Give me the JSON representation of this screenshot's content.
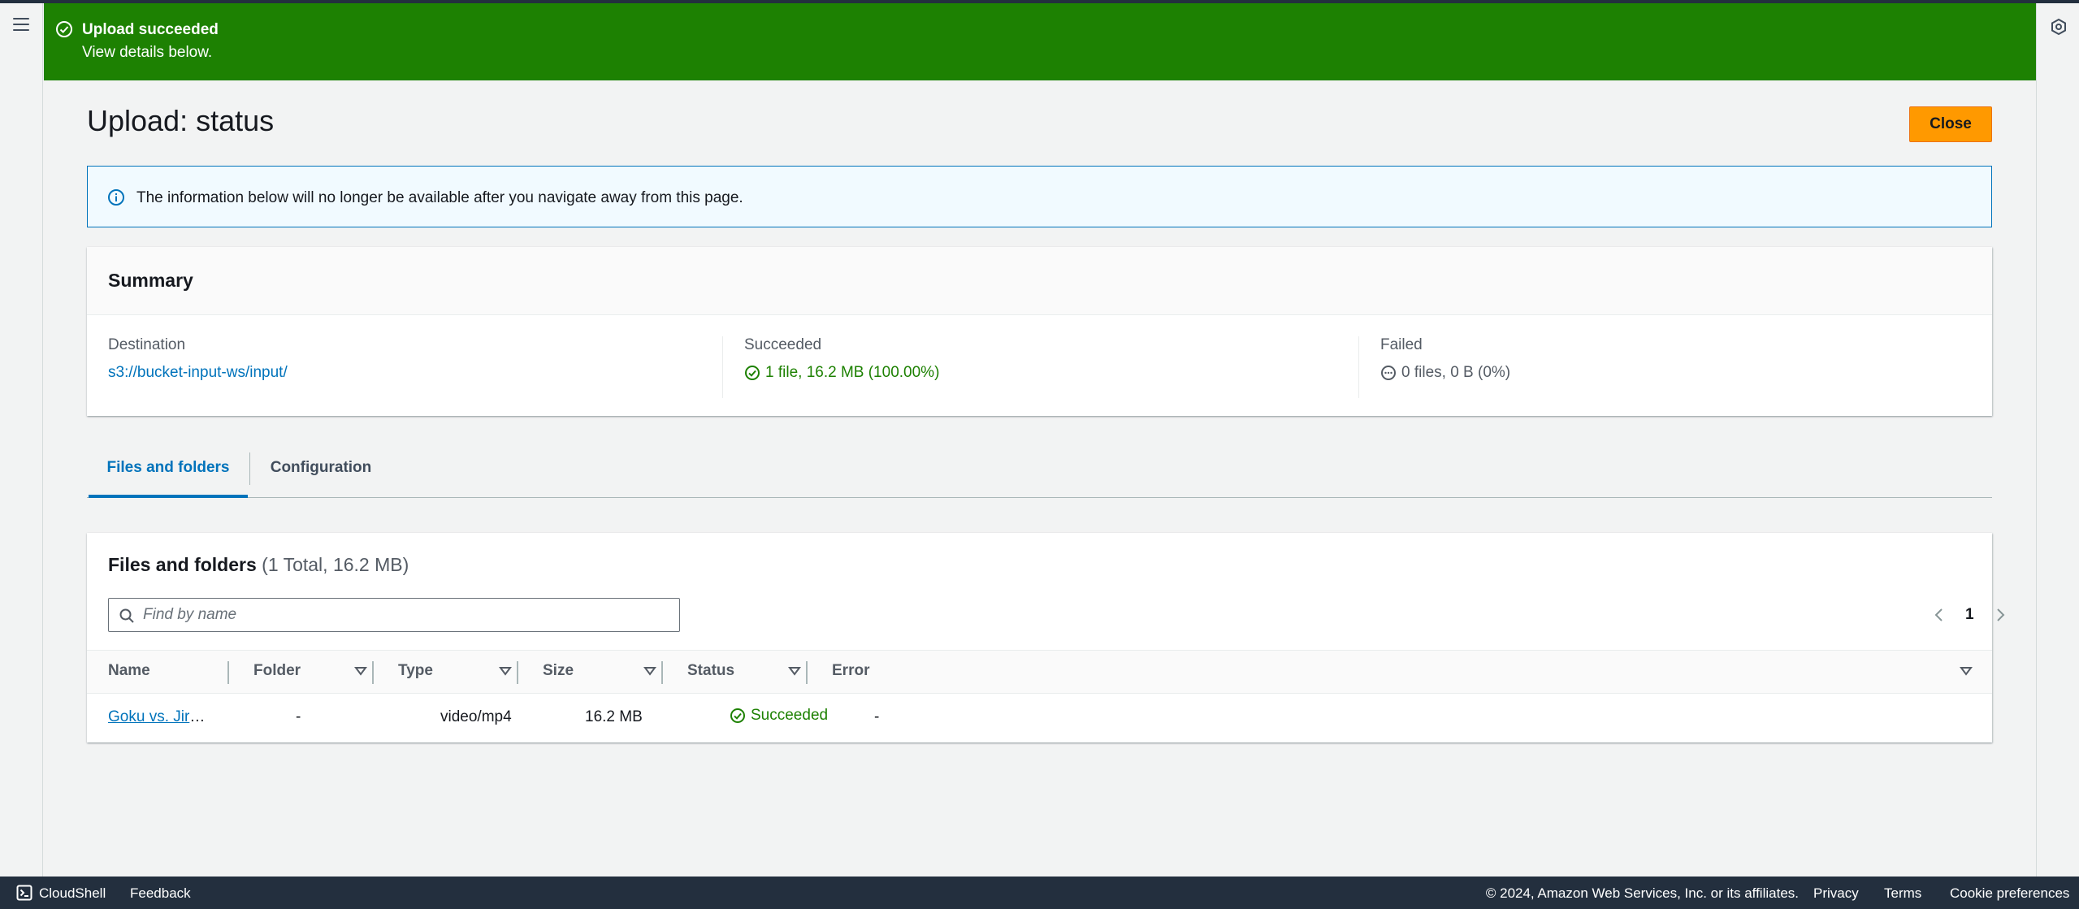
{
  "flash": {
    "title": "Upload succeeded",
    "message": "View details below."
  },
  "page": {
    "title": "Upload: status",
    "close_label": "Close"
  },
  "info": {
    "text": "The information below will no longer be available after you navigate away from this page."
  },
  "summary": {
    "title": "Summary",
    "destination": {
      "label": "Destination",
      "value": "s3://bucket-input-ws/input/"
    },
    "succeeded": {
      "label": "Succeeded",
      "value": "1 file, 16.2 MB (100.00%)"
    },
    "failed": {
      "label": "Failed",
      "value": "0 files, 0 B (0%)"
    }
  },
  "tabs": [
    {
      "label": "Files and folders",
      "active": true
    },
    {
      "label": "Configuration",
      "active": false
    }
  ],
  "files": {
    "title": "Files and folders",
    "count": "(1 Total, 16.2 MB)",
    "search_placeholder": "Find by name",
    "page": "1",
    "columns": [
      "Name",
      "Folder",
      "Type",
      "Size",
      "Status",
      "Error"
    ],
    "rows": [
      {
        "name": "Goku vs. Jire…",
        "folder": "-",
        "type": "video/mp4",
        "size": "16.2 MB",
        "status": "Succeeded",
        "error": "-"
      }
    ]
  },
  "footer": {
    "cloudshell": "CloudShell",
    "feedback": "Feedback",
    "copyright": "© 2024, Amazon Web Services, Inc. or its affiliates.",
    "privacy": "Privacy",
    "terms": "Terms",
    "cookies": "Cookie preferences"
  },
  "colors": {
    "success": "#1d8102",
    "link": "#0073bb",
    "primary_button": "#ff9900",
    "footer_bg": "#232f3e"
  },
  "icons": {
    "flash": "check-circle-icon",
    "info": "info-circle-icon",
    "search": "search-icon",
    "pager_prev": "chevron-left-icon",
    "pager_next": "chevron-right-icon",
    "sort": "caret-down-icon",
    "footer": "cloudshell-icon",
    "tools": "tools-panel-icon"
  }
}
